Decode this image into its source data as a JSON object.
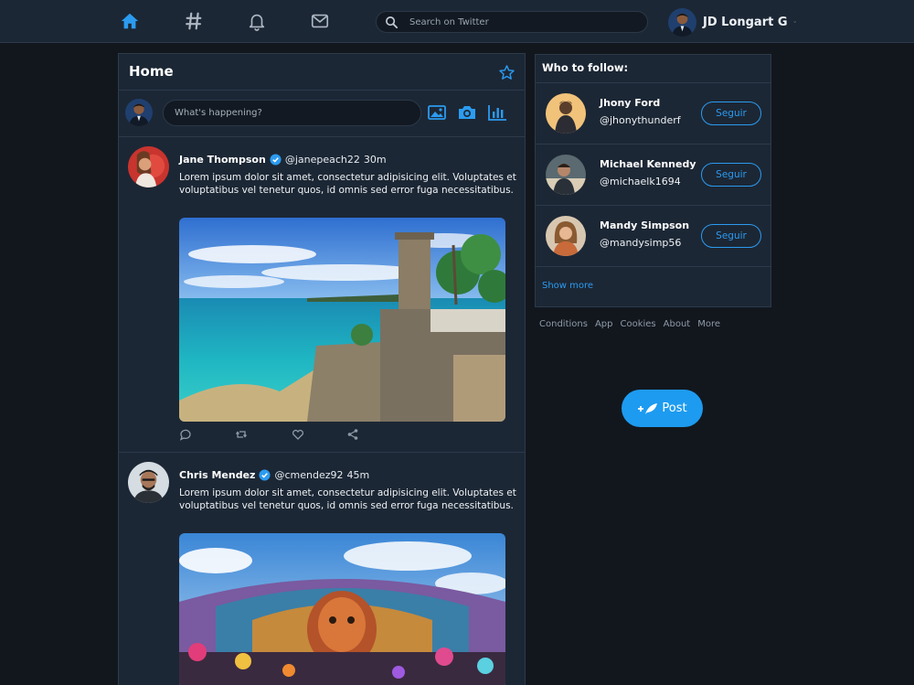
{
  "topbar": {
    "nav": [
      {
        "name": "home-icon",
        "active": true
      },
      {
        "name": "hashtag-icon",
        "active": false
      },
      {
        "name": "bell-icon",
        "active": false
      },
      {
        "name": "mail-icon",
        "active": false
      }
    ],
    "search_placeholder": "Search on Twitter",
    "profile_name": "JD Longart G"
  },
  "feed": {
    "title": "Home",
    "composer_placeholder": "What's happening?",
    "composer_icons": [
      "image-icon",
      "camera-icon",
      "poll-icon"
    ]
  },
  "tweets": [
    {
      "name": "Jane Thompson",
      "handle": "@janepeach22",
      "time": "30m",
      "text": "Lorem ipsum dolor sit amet, consectetur adipisicing elit. Voluptates et voluptatibus vel tenetur quos, id omnis sed error fuga necessitatibus."
    },
    {
      "name": "Chris Mendez",
      "handle": "@cmendez92",
      "time": "45m",
      "text": "Lorem ipsum dolor sit amet, consectetur adipisicing elit. Voluptates et voluptatibus vel tenetur quos, id omnis sed error fuga necessitatibus."
    }
  ],
  "who_to_follow": {
    "title": "Who to follow:",
    "users": [
      {
        "name": "Jhony Ford",
        "handle": "@jhonythunderf",
        "button": "Seguir"
      },
      {
        "name": "Michael Kennedy",
        "handle": "@michaelk1694",
        "button": "Seguir"
      },
      {
        "name": "Mandy Simpson",
        "handle": "@mandysimp56",
        "button": "Seguir"
      }
    ],
    "show_more": "Show more"
  },
  "footer_links": [
    "Conditions",
    "App",
    "Cookies",
    "About",
    "More"
  ],
  "post_button": "Post",
  "colors": {
    "accent": "#1d9bf0",
    "panel": "#1c2735",
    "background": "#12171e",
    "border": "#2c3a4b"
  }
}
